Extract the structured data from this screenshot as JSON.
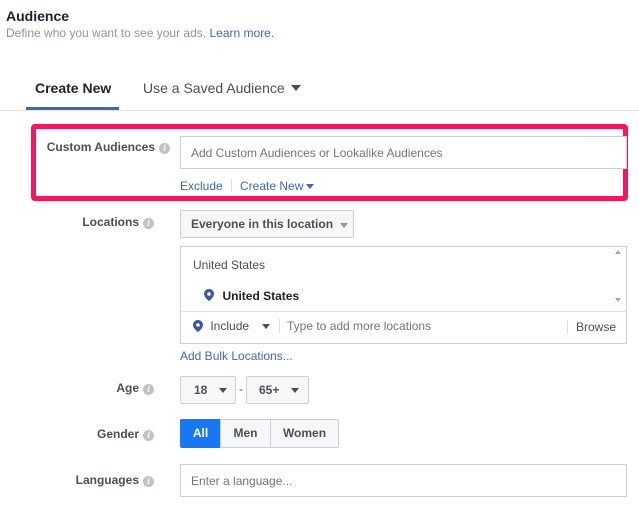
{
  "header": {
    "title": "Audience",
    "subtitle": "Define who you want to see your ads.",
    "learn_more": "Learn more."
  },
  "tabs": [
    {
      "label": "Create New",
      "active": true
    },
    {
      "label": "Use a Saved Audience",
      "active": false
    }
  ],
  "custom_audiences": {
    "label": "Custom Audiences",
    "placeholder": "Add Custom Audiences or Lookalike Audiences",
    "exclude": "Exclude",
    "create_new": "Create New"
  },
  "locations": {
    "label": "Locations",
    "dropdown_value": "Everyone in this location",
    "group_header": "United States",
    "selected_item": "United States",
    "include_value": "Include",
    "placeholder": "Type to add more locations",
    "browse": "Browse",
    "bulk_link": "Add Bulk Locations..."
  },
  "age": {
    "label": "Age",
    "min": "18",
    "separator": "-",
    "max": "65+"
  },
  "gender": {
    "label": "Gender",
    "options": [
      "All",
      "Men",
      "Women"
    ],
    "selected": "All"
  },
  "languages": {
    "label": "Languages",
    "placeholder": "Enter a language..."
  },
  "colors": {
    "accent": "#4267b2",
    "highlight": "#f0195c",
    "selected_segment": "#1877f2"
  },
  "icons": {
    "info": "info-icon",
    "location_pin": "map-pin-icon",
    "caret": "caret-down-icon"
  }
}
